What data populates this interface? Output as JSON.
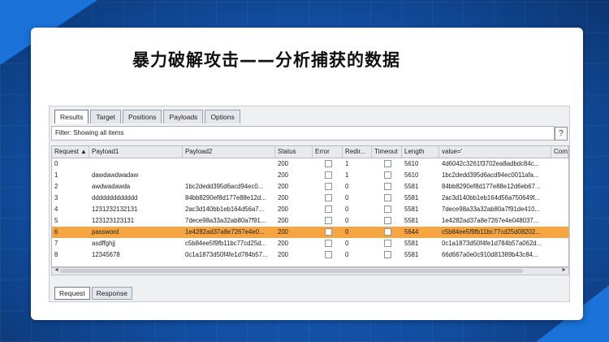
{
  "slide": {
    "title": "暴力破解攻击——分析捕获的数据"
  },
  "tabs": [
    "Results",
    "Target",
    "Positions",
    "Payloads",
    "Options"
  ],
  "filter": {
    "text": "Filter: Showing all items",
    "help": "?"
  },
  "columns": [
    "Request ▲",
    "Payload1",
    "Payload2",
    "Status",
    "Error",
    "Redir...",
    "Timeout",
    "Length",
    "value='",
    "Com"
  ],
  "rows": [
    {
      "request": "0",
      "payload1": "",
      "payload2": "",
      "status": "200",
      "redirect": "1",
      "length": "5610",
      "value": "4d6042c3261f3702ea8adbdc84c..."
    },
    {
      "request": "1",
      "payload1": "dawdawdwadaw",
      "payload2": "",
      "status": "200",
      "redirect": "1",
      "length": "5610",
      "value": "1bc2dedd395d6acd94ec0011afa..."
    },
    {
      "request": "2",
      "payload1": "awdwadawda",
      "payload2": "1bc2dedd395d6acd94ec0...",
      "status": "200",
      "redirect": "0",
      "length": "5581",
      "value": "84bb8290ef8d177e88e12d6eb67..."
    },
    {
      "request": "3",
      "payload1": "ddddddddddddd",
      "payload2": "84bb8290ef8d177e88e12d...",
      "status": "200",
      "redirect": "0",
      "length": "5581",
      "value": "2ac3d140bb1eb164d56a750649f..."
    },
    {
      "request": "4",
      "payload1": "1231232132131",
      "payload2": "2ac3d140bb1eb164d56a7...",
      "status": "200",
      "redirect": "0",
      "length": "5581",
      "value": "7dece98a33a32ab80a7f91de410..."
    },
    {
      "request": "5",
      "payload1": "123123123131",
      "payload2": "7dece98a33a32ab80a7f91...",
      "status": "200",
      "redirect": "0",
      "length": "5581",
      "value": "1e4282ad37a8e7267e4e048037..."
    },
    {
      "request": "6",
      "payload1": "password",
      "payload2": "1e4282ad37a8e7267e4e0...",
      "status": "200",
      "redirect": "0",
      "length": "5644",
      "value": "c5b84ee5f9fb11bc77cd25d08202...",
      "selected": true
    },
    {
      "request": "7",
      "payload1": "asdffghjj",
      "payload2": "c5b84ee5f9fb11bc77cd25d...",
      "status": "200",
      "redirect": "0",
      "length": "5581",
      "value": "0c1a1873d50f4fe1d784b57a062d..."
    },
    {
      "request": "8",
      "payload1": "12345678",
      "payload2": "0c1a1873d50f4fe1d784b57...",
      "status": "200",
      "redirect": "0",
      "length": "5581",
      "value": "66d667a0e0c910d81389b43c84..."
    }
  ],
  "bottom_tabs": [
    "Request",
    "Response"
  ],
  "colors": {
    "selected_row": "#f7a540",
    "background": "#1558b3"
  }
}
